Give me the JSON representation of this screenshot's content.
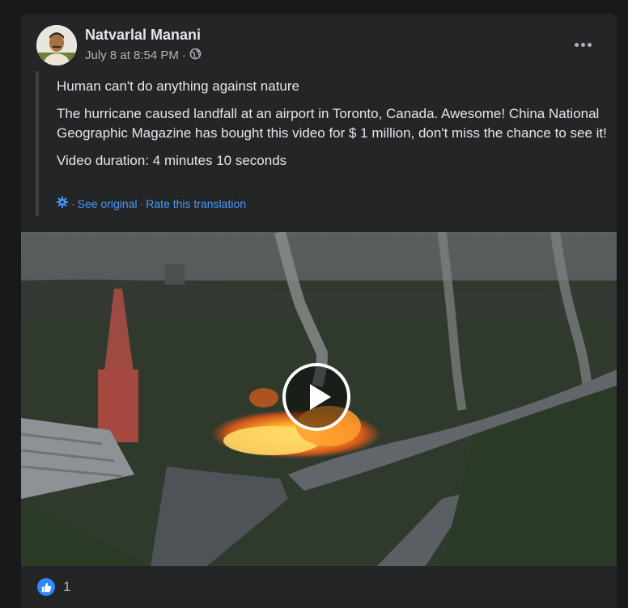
{
  "post": {
    "author": "Natvarlal Manani",
    "timestamp": "July 8 at 8:54 PM",
    "dot": "·",
    "privacy_icon": "globe-icon",
    "paragraphs": [
      "Human can't do anything against nature",
      "The hurricane caused landfall at an airport in Toronto, Canada. Awesome! China National Geographic Magazine has bought this video for $ 1 million, don't miss the chance to see it!",
      "Video duration: 4 minutes 10 seconds"
    ],
    "translation": {
      "icon": "gear-icon",
      "sep1": "·",
      "see_original": "See original",
      "sep2": "·",
      "rate": "Rate this translation"
    },
    "more_icon": "more-options-icon"
  },
  "video": {
    "play_icon": "play-icon"
  },
  "reactions": {
    "icon": "like-icon",
    "count": "1"
  },
  "colors": {
    "background": "#18191a",
    "card": "#242526",
    "text": "#e4e6eb",
    "muted": "#b0b3b8",
    "link": "#4599ff",
    "like": "#2d88ff"
  }
}
